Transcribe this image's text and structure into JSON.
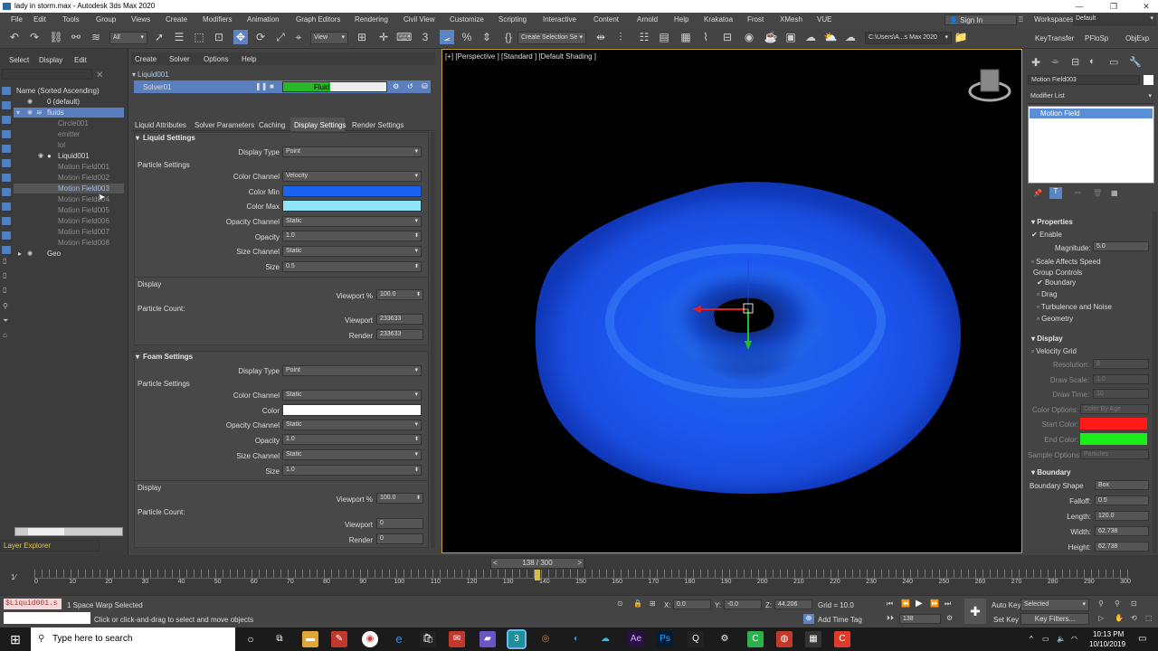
{
  "window": {
    "title": "lady in storm.max - Autodesk 3ds Max 2020"
  },
  "menu": [
    "File",
    "Edit",
    "Tools",
    "Group",
    "Views",
    "Create",
    "Modifiers",
    "Animation",
    "Graph Editors",
    "Rendering",
    "Civil View",
    "Customize",
    "Scripting",
    "Interactive",
    "Content",
    "Arnold",
    "Help",
    "Krakatoa",
    "Frost",
    "XMesh",
    "VUE"
  ],
  "account": {
    "sign_in": "Sign In",
    "workspaces_label": "Workspaces:",
    "workspace": "Default"
  },
  "toolbar": {
    "filter": "All",
    "ref_coord": "View",
    "selection_set": "Create Selection Se",
    "project_path": "C:\\Users\\A...s Max 2020",
    "key_transfer": "KeyTransfer",
    "pflotsp": "PFloSp",
    "objexp": "ObjExp"
  },
  "scene_explorer": {
    "menu": [
      "Select",
      "Display",
      "Edit"
    ],
    "header": "Name (Sorted Ascending)",
    "rows": [
      "0 (default)",
      "fluids",
      "Circle001",
      "emitter",
      "lol",
      "Liquid001",
      "Motion Field001",
      "Motion Field002",
      "Motion Field003",
      "Motion Field004",
      "Motion Field005",
      "Motion Field006",
      "Motion Field007",
      "Motion Field008",
      "Geo"
    ],
    "layer_explorer": "Layer Explorer"
  },
  "liquid": {
    "tree_root": "Liquid001",
    "solver": "Solver01",
    "progress_label": "Fluid",
    "menu": [
      "Create",
      "Solver",
      "Options",
      "Help"
    ],
    "tabs": [
      "Liquid Attributes",
      "Solver Parameters",
      "Caching",
      "Display Settings",
      "Render Settings"
    ],
    "liquid_settings": {
      "title": "Liquid Settings",
      "display_type_label": "Display Type",
      "display_type": "Point",
      "particle_settings": "Particle Settings",
      "color_channel_label": "Color Channel",
      "color_channel": "Velocity",
      "color_min_label": "Color Min",
      "color_min": "#1a63f0",
      "color_max_label": "Color Max",
      "color_max": "#8fe4f5",
      "opacity_channel_label": "Opacity Channel",
      "opacity_channel": "Static",
      "opacity_label": "Opacity",
      "opacity": "1.0",
      "size_channel_label": "Size Channel",
      "size_channel": "Static",
      "size_label": "Size",
      "size": "0.5",
      "display": "Display",
      "viewport_pct_label": "Viewport %",
      "viewport_pct": "100.0",
      "particle_count": "Particle Count:",
      "viewport_label": "Viewport",
      "viewport": "233633",
      "render_label": "Render",
      "render": "233633"
    },
    "foam_settings": {
      "title": "Foam Settings",
      "display_type_label": "Display Type",
      "display_type": "Point",
      "particle_settings": "Particle Settings",
      "color_channel_label": "Color Channel",
      "color_channel": "Static",
      "color_label": "Color",
      "color": "#ffffff",
      "opacity_channel_label": "Opacity Channel",
      "opacity_channel": "Static",
      "opacity_label": "Opacity",
      "opacity": "1.0",
      "size_channel_label": "Size Channel",
      "size_channel": "Static",
      "size_label": "Size",
      "size": "1.0",
      "display": "Display",
      "viewport_pct_label": "Viewport %",
      "viewport_pct": "100.0",
      "particle_count": "Particle Count:",
      "viewport_label": "Viewport",
      "viewport": "0",
      "render_label": "Render",
      "render": "0"
    }
  },
  "viewport": {
    "label": "[+] [Perspective ] [Standard ] [Default Shading ]"
  },
  "command_panel": {
    "object_name": "Motion Field003",
    "modifier_list": "Modifier List",
    "stack_item": "Motion Field",
    "properties": "Properties",
    "enable": "Enable",
    "magnitude_label": "Magnitude:",
    "magnitude": "5.0",
    "scale_affects_speed": "Scale Affects Speed",
    "group_controls": "Group Controls",
    "groups": [
      "Boundary",
      "Drag",
      "Turbulence and Noise",
      "Geometry"
    ],
    "display": "Display",
    "velocity_grid": "Velocity Grid",
    "resolution_label": "Resolution:",
    "resolution": "8",
    "draw_scale_label": "Draw Scale:",
    "draw_scale": "1.0",
    "draw_time_label": "Draw Time:",
    "draw_time": "10",
    "color_options_label": "Color Options:",
    "color_options": "Color By Age",
    "start_color_label": "Start Color:",
    "start_color": "#ff1a1a",
    "end_color_label": "End Color:",
    "end_color": "#1aee1a",
    "sample_options_label": "Sample Options:",
    "sample_options": "Particles",
    "boundary": "Boundary",
    "boundary_shape_label": "Boundary Shape",
    "boundary_shape": "Box",
    "falloff_label": "Falloff:",
    "falloff": "0.5",
    "length_label": "Length:",
    "length": "120.0",
    "width_label": "Width:",
    "width": "62.738",
    "height_label": "Height:",
    "height": "62.738"
  },
  "timeline": {
    "frame": "138 / 300",
    "current": 138,
    "max": 300,
    "ticks": [
      "0",
      "10",
      "20",
      "30",
      "40",
      "50",
      "60",
      "70",
      "80",
      "90",
      "100",
      "110",
      "120",
      "130",
      "140",
      "150",
      "160",
      "170",
      "180",
      "190",
      "200",
      "210",
      "220",
      "230",
      "240",
      "250",
      "260",
      "270",
      "280",
      "290",
      "300"
    ]
  },
  "status": {
    "script": "$Liquid001.s",
    "selection": "1 Space Warp Selected",
    "prompt": "Click or click-and-drag to select and move objects",
    "x_label": "X:",
    "x": "0.0",
    "y_label": "Y:",
    "y": "-0.0",
    "z_label": "Z:",
    "z": "44.206",
    "grid": "Grid = 10.0",
    "add_time_tag": "Add Time Tag",
    "auto_key": "Auto Key",
    "selected": "Selected",
    "set_key": "Set Key",
    "key_filters": "Key Filters...",
    "frame_field": "138"
  },
  "taskbar": {
    "search": "Type here to search",
    "time": "10:13 PM",
    "date": "10/10/2019"
  }
}
